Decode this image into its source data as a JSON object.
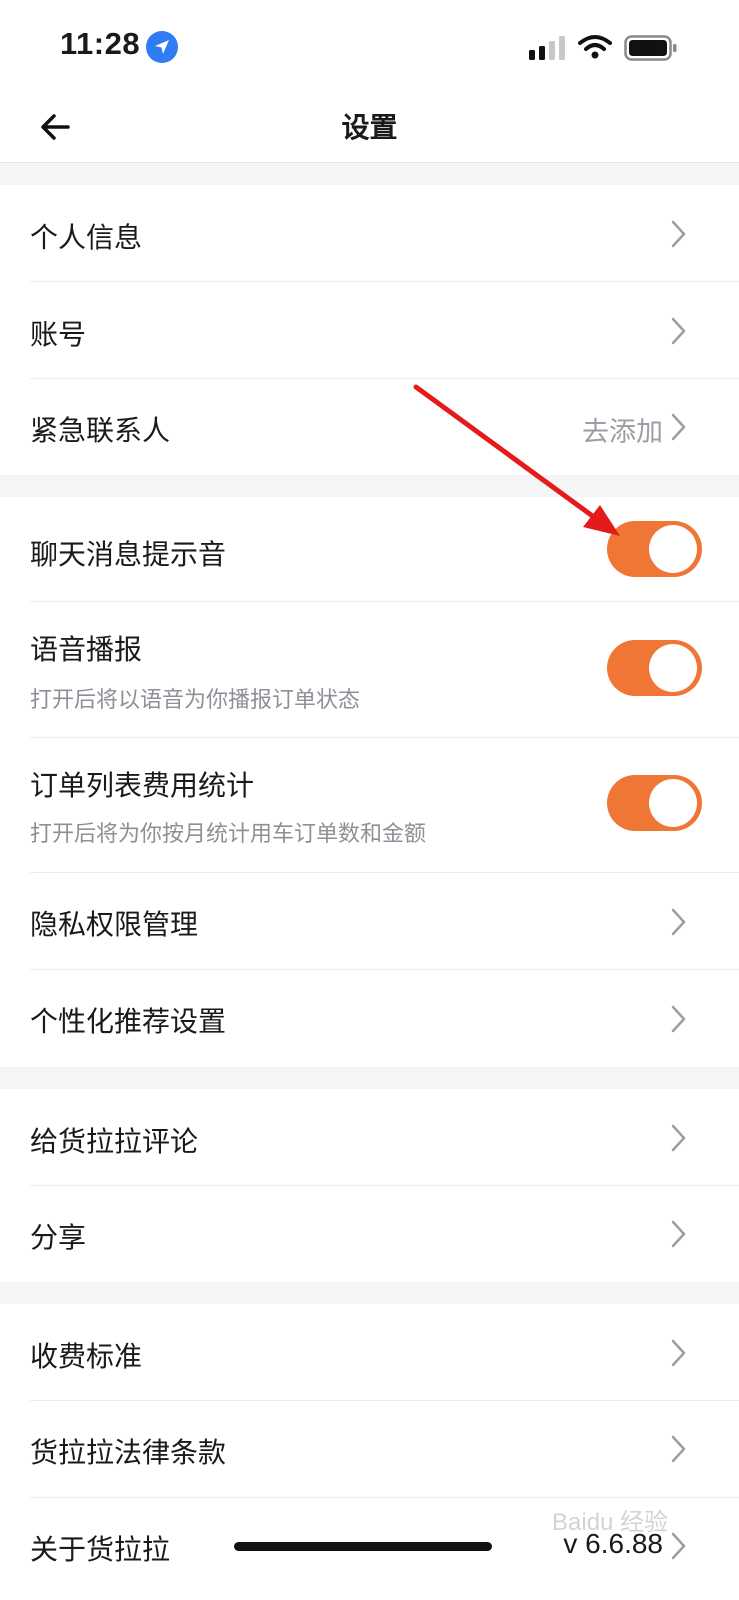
{
  "status_bar": {
    "time": "11:28"
  },
  "header": {
    "title": "设置"
  },
  "colors": {
    "accent": "#f07636",
    "annotation": "#e51b1b"
  },
  "sections": {
    "account": {
      "personal_info": "个人信息",
      "account": "账号",
      "emergency_contact": {
        "label": "紧急联系人",
        "value": "去添加"
      }
    },
    "preferences": {
      "chat_sound": {
        "label": "聊天消息提示音",
        "enabled": true
      },
      "voice_broadcast": {
        "label": "语音播报",
        "description": "打开后将以语音为你播报订单状态",
        "enabled": true
      },
      "order_stats": {
        "label": "订单列表费用统计",
        "description": "打开后将为你按月统计用车订单数和金额",
        "enabled": true
      },
      "privacy": "隐私权限管理",
      "personalized": "个性化推荐设置"
    },
    "feedback": {
      "review": "给货拉拉评论",
      "share": "分享"
    },
    "about": {
      "fees": "收费标准",
      "legal": "货拉拉法律条款",
      "about_app": {
        "label": "关于货拉拉",
        "version": "v 6.6.88"
      }
    }
  },
  "watermark": "Baidu 经验"
}
